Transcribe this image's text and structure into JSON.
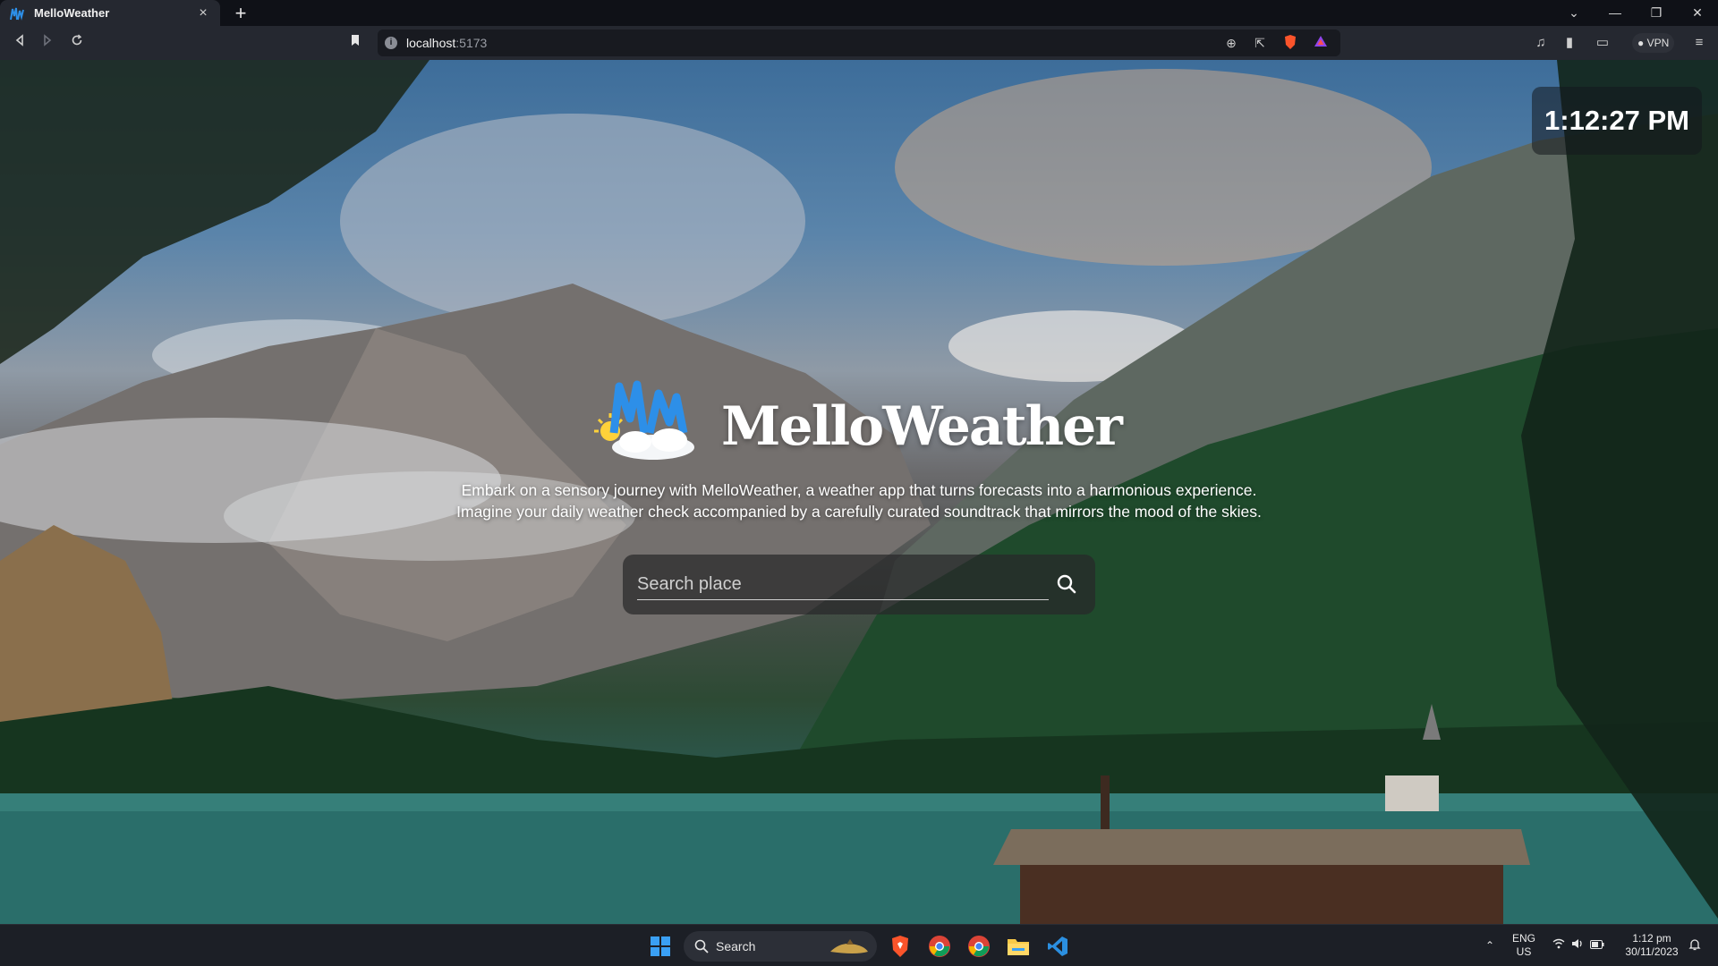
{
  "browser": {
    "tab": {
      "title": "MelloWeather"
    },
    "new_tab_label": "+",
    "url": {
      "host": "localhost",
      "port": ":5173"
    },
    "vpn_label": "VPN"
  },
  "page": {
    "clock": "1:12:27 PM",
    "brand": "MelloWeather",
    "brand_part1": "Mello",
    "brand_part2": "Weather",
    "tagline": "Embark on a sensory journey with MelloWeather, a weather app that turns forecasts into a harmonious experience. Imagine your daily weather check accompanied by a carefully curated soundtrack that mirrors the mood of the skies.",
    "search": {
      "placeholder": "Search place",
      "value": ""
    }
  },
  "taskbar": {
    "search_label": "Search",
    "language": {
      "line1": "ENG",
      "line2": "US"
    },
    "time": "1:12 pm",
    "date": "30/11/2023"
  },
  "colors": {
    "brand_blue": "#2d8fe8",
    "windows_blue": "#3aa0f5",
    "brave_orange": "#fb542b",
    "vscode_blue": "#2b8fe0"
  }
}
